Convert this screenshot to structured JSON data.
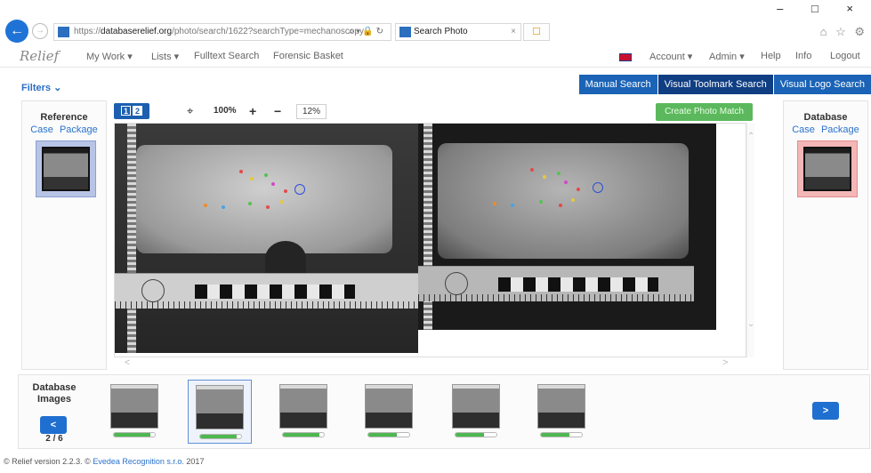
{
  "browser": {
    "url_scheme": "https://",
    "url_host": "databaserelief.org",
    "url_path": "/photo/search/1622?searchType=mechanoscopy",
    "url_tools": "⌕ ▾ 🔒 ↻",
    "tab_title": "Search Photo",
    "tab_close": "×",
    "window_controls": "– □ ×",
    "toolbar_icons": "⌂ ☆ ⚙"
  },
  "nav": {
    "logo": "Relief",
    "items": [
      "My Work ▾",
      "Lists ▾",
      "Fulltext Search",
      "Forensic Basket"
    ],
    "right_items": [
      "Account ▾",
      "Admin ▾",
      "Help",
      "Info",
      "Logout"
    ]
  },
  "filters": {
    "label": "Filters ⌄"
  },
  "search_modes": [
    {
      "label": "Manual Search",
      "active": false
    },
    {
      "label": "Visual Toolmark Search",
      "active": true
    },
    {
      "label": "Visual Logo Search",
      "active": false
    }
  ],
  "reference": {
    "title": "Reference",
    "links": [
      "Case",
      "Package"
    ]
  },
  "database": {
    "title": "Database",
    "links": [
      "Case",
      "Package"
    ]
  },
  "viewer": {
    "layout_icons": [
      "1",
      "2"
    ],
    "fit_icon": "⌖",
    "zoom_100": "100%",
    "zoom_in": "+",
    "zoom_out": "−",
    "zoom_level": "12%",
    "create_match": "Create Photo Match",
    "scroll_up": "⌃",
    "scroll_down": "⌄",
    "scroll_left": "<",
    "scroll_right": ">"
  },
  "strip": {
    "label": "Database Images",
    "prev": "<",
    "next": ">",
    "page": "2 / 6",
    "thumbs": [
      {
        "progress": 0.9,
        "active": false
      },
      {
        "progress": 0.9,
        "active": true
      },
      {
        "progress": 0.9,
        "active": false
      },
      {
        "progress": 0.7,
        "active": false
      },
      {
        "progress": 0.7,
        "active": false
      },
      {
        "progress": 0.7,
        "active": false
      }
    ]
  },
  "footer": {
    "prefix": "© Relief version 2.2.3. ©",
    "company": "Evedea Recognition s.r.o.",
    "year": "2017"
  },
  "colors": {
    "primary": "#1b63b6",
    "active_tab": "#103e83",
    "green": "#5cb85c",
    "link": "#2a72cc"
  }
}
